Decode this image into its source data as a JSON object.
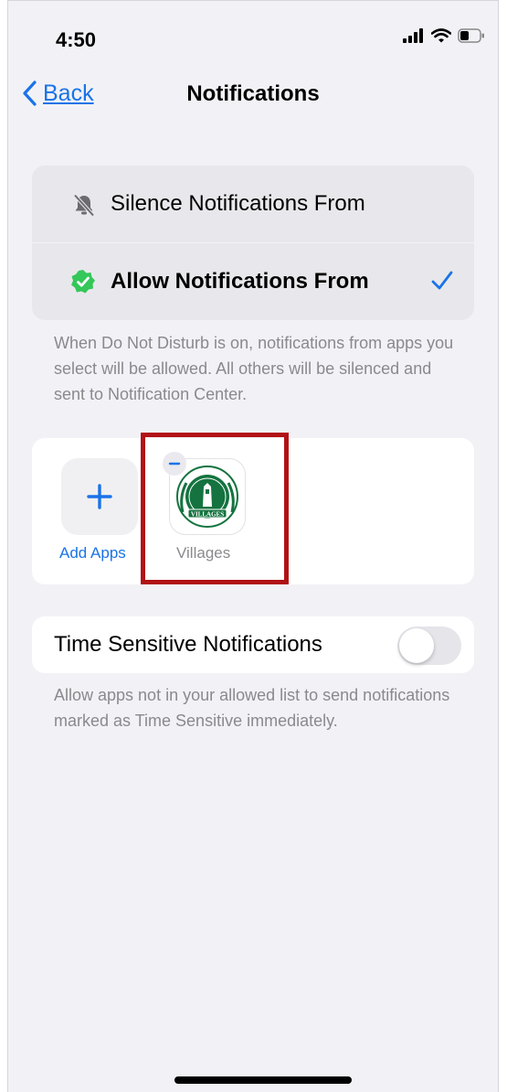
{
  "status_bar": {
    "time": "4:50",
    "icons": [
      "signal-bars-icon",
      "wifi-icon",
      "battery-icon"
    ]
  },
  "nav": {
    "back_label": "Back",
    "title": "Notifications"
  },
  "options": [
    {
      "label": "Silence Notifications From",
      "icon": "bell-slash-icon",
      "selected": false
    },
    {
      "label": "Allow Notifications From",
      "icon": "checkmark-seal-icon",
      "selected": true
    }
  ],
  "options_footnote": "When Do Not Disturb is on, notifications from apps you select will be allowed. All others will be silenced and sent to Notification Center.",
  "apps": {
    "add_label": "Add Apps",
    "items": [
      {
        "name": "Villages",
        "logo_text": "VILLAGES"
      }
    ]
  },
  "time_sensitive": {
    "label": "Time Sensitive Notifications",
    "enabled": false,
    "footnote": "Allow apps not in your allowed list to send notifications marked as Time Sensitive immediately."
  },
  "colors": {
    "accent": "#1a73e8",
    "background": "#f2f2f6",
    "highlight_box": "#b11216",
    "allow_badge_green": "#34c759",
    "app_logo_green": "#14733f"
  }
}
